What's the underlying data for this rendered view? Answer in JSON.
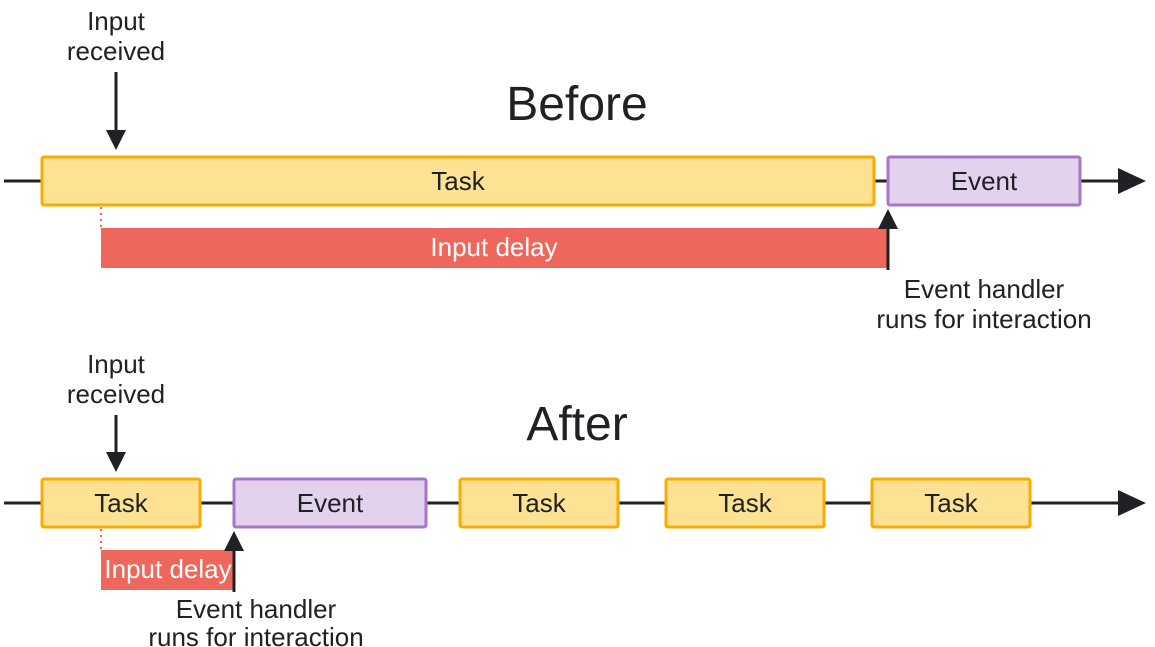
{
  "before": {
    "heading": "Before",
    "input_received_l1": "Input",
    "input_received_l2": "received",
    "task_label": "Task",
    "event_label": "Event",
    "delay_label": "Input delay",
    "handler_l1": "Event handler",
    "handler_l2": "runs for interaction"
  },
  "after": {
    "heading": "After",
    "input_received_l1": "Input",
    "input_received_l2": "received",
    "tasks": [
      "Task",
      "Task",
      "Task",
      "Task"
    ],
    "event_label": "Event",
    "delay_label": "Input delay",
    "handler_l1": "Event handler",
    "handler_l2": "runs for interaction"
  }
}
